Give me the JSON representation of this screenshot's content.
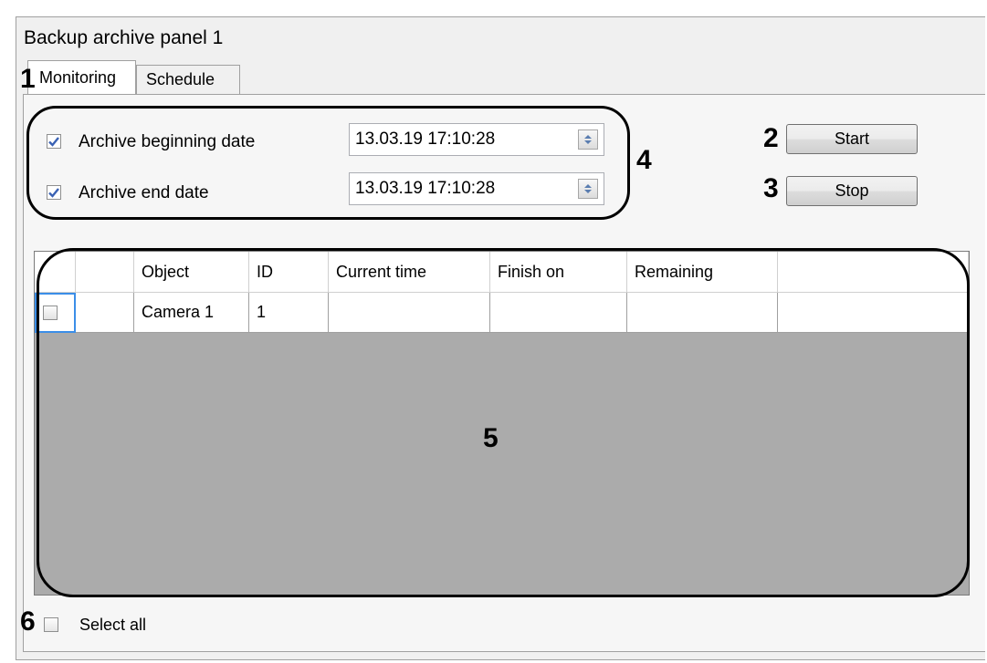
{
  "panel": {
    "title": "Backup archive panel 1"
  },
  "tabs": [
    {
      "label": "Monitoring",
      "active": true
    },
    {
      "label": "Schedule",
      "active": false
    }
  ],
  "callouts": {
    "c1": "1",
    "c2": "2",
    "c3": "3",
    "c4": "4",
    "c5": "5",
    "c6": "6"
  },
  "dates": {
    "begin": {
      "label": "Archive beginning date",
      "checked": true,
      "value": "13.03.19 17:10:28"
    },
    "end": {
      "label": "Archive end date",
      "checked": true,
      "value": "13.03.19 17:10:28"
    }
  },
  "buttons": {
    "start": "Start",
    "stop": "Stop"
  },
  "table": {
    "columns": [
      "",
      "",
      "Object",
      "ID",
      "Current time",
      "Finish on",
      "Remaining",
      ""
    ],
    "rows": [
      {
        "checked": false,
        "object": "Camera 1",
        "id": "1",
        "current_time": "",
        "finish_on": "",
        "remaining": ""
      }
    ]
  },
  "select_all": {
    "label": "Select all",
    "checked": false
  },
  "colors": {
    "window_bg": "#f0f0f0",
    "grid_bg": "#ababab",
    "check_blue": "#3a62b4"
  },
  "icons": {
    "checkbox_check": "check-icon",
    "spin_up": "chevron-up-icon",
    "spin_down": "chevron-down-icon"
  }
}
